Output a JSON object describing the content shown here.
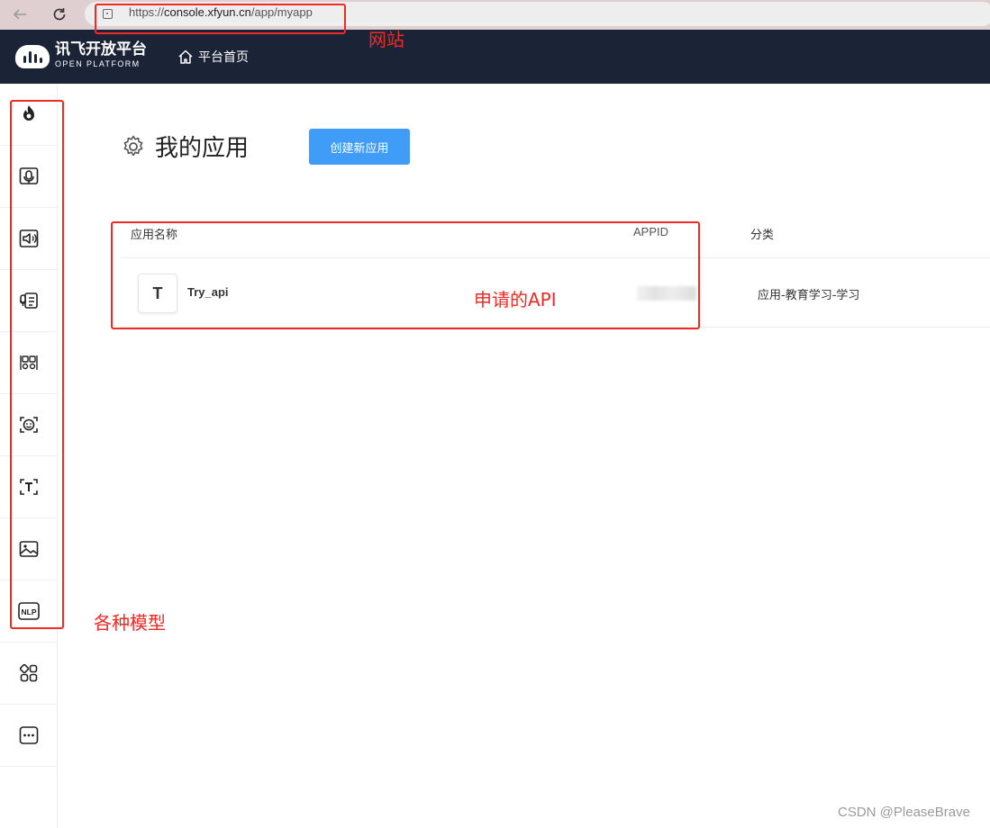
{
  "browser": {
    "url_prefix": "https://",
    "url_host": "console.xfyun.cn",
    "url_path": "/app/myapp"
  },
  "header": {
    "logo_cn": "讯飞开放平台",
    "logo_en": "OPEN PLATFORM",
    "home_label": "平台首页"
  },
  "sidebar": {
    "items": [
      {
        "icon": "spark-flame-icon"
      },
      {
        "icon": "speech-recognition-icon"
      },
      {
        "icon": "speech-synthesis-icon"
      },
      {
        "icon": "speech-evaluation-icon"
      },
      {
        "icon": "translation-icon"
      },
      {
        "icon": "face-recognition-icon"
      },
      {
        "icon": "text-recognition-icon"
      },
      {
        "icon": "image-recognition-icon"
      },
      {
        "icon": "nlp-icon"
      },
      {
        "icon": "apps-grid-icon"
      },
      {
        "icon": "more-icon"
      }
    ]
  },
  "main": {
    "title": "我的应用",
    "create_button": "创建新应用",
    "table": {
      "headers": {
        "name": "应用名称",
        "appid": "APPID",
        "category": "分类"
      },
      "rows": [
        {
          "avatar": "T",
          "name": "Try_api",
          "appid": "",
          "category": "应用-教育学习-学习"
        }
      ]
    }
  },
  "annotations": {
    "website": "网站",
    "applied_api": "申请的API",
    "models": "各种模型",
    "color": "#f02a24"
  },
  "watermark": "CSDN @PleaseBrave",
  "colors": {
    "header_bg": "#1b2337",
    "primary_button": "#3f9cf7",
    "browser_bar": "#dfcfd0"
  }
}
